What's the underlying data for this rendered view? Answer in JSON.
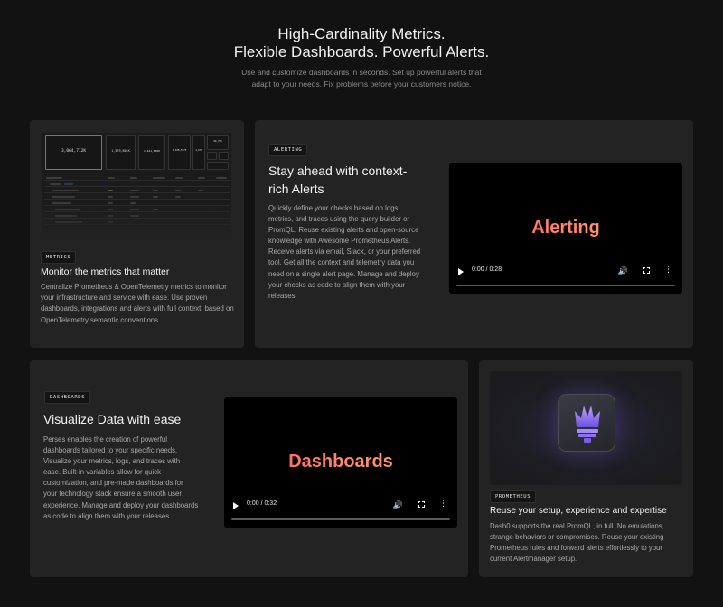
{
  "hero": {
    "title_line1": "High-Cardinality Metrics.",
    "title_line2": "Flexible Dashboards. Powerful Alerts.",
    "subtitle_line1": "Use and customize dashboards in seconds. Set up powerful alerts that",
    "subtitle_line2": "adapt to your needs. Fix problems before your customers notice."
  },
  "metrics_card": {
    "badge": "METRICS",
    "title": "Monitor the metrics that matter",
    "text": "Centralize Prometheus & OpenTelemetry metrics to monitor your infrastructure and service with ease. Use proven dashboards, integrations and alerts with full context, based on OpenTelemetry semantic conventions.",
    "dashboard_stats": [
      "3,064,712K",
      "1,579,801K",
      "1,421,860K",
      "1,306,507K",
      "4,976",
      "90,756"
    ]
  },
  "alerting_card": {
    "badge": "ALERTING",
    "title": "Stay ahead with context-rich Alerts",
    "text": "Quickly define your checks based on logs, metrics, and traces using the query builder or PromQL. Reuse existing alerts and open-source knowledge with Awesome Prometheus Alerts. Receive alerts via email, Slack, or your preferred tool. Get all the context and telemetry data you need on a single alert page. Manage and deploy your checks as code to align them with your releases.",
    "video_title": "Alerting",
    "video_time": "0:00 / 0:28"
  },
  "dashboards_card": {
    "badge": "DASHBOARDS",
    "title": "Visualize Data with ease",
    "text": "Perses enables the creation of powerful dashboards tailored to your specific needs. Visualize your metrics, logs, and traces with ease. Built-in variables allow for quick customization, and pre-made dashboards for your technology stack ensure a smooth user experience. Manage and deploy your dashboards as code to align them with your releases.",
    "video_title": "Dashboards",
    "video_time": "0:00 / 0:32"
  },
  "prometheus_card": {
    "badge": "PROMETHEUS",
    "title": "Reuse your setup, experience and expertise",
    "text": "Dash0 supports the real PromQL, in full. No emulations, strange behaviors or compromises. Reuse your existing Prometheus rules and forward alerts effortlessly to your current Alertmanager setup."
  },
  "colors": {
    "background": "#121212",
    "card": "#232323",
    "video_title_gradient_start": "#ff5a5a",
    "video_title_gradient_end": "#ffb07a",
    "prometheus_flame": "#8b6cf0"
  },
  "icons": [
    "play-icon",
    "volume-icon",
    "fullscreen-icon",
    "more-options-icon",
    "prometheus-torch-icon"
  ]
}
